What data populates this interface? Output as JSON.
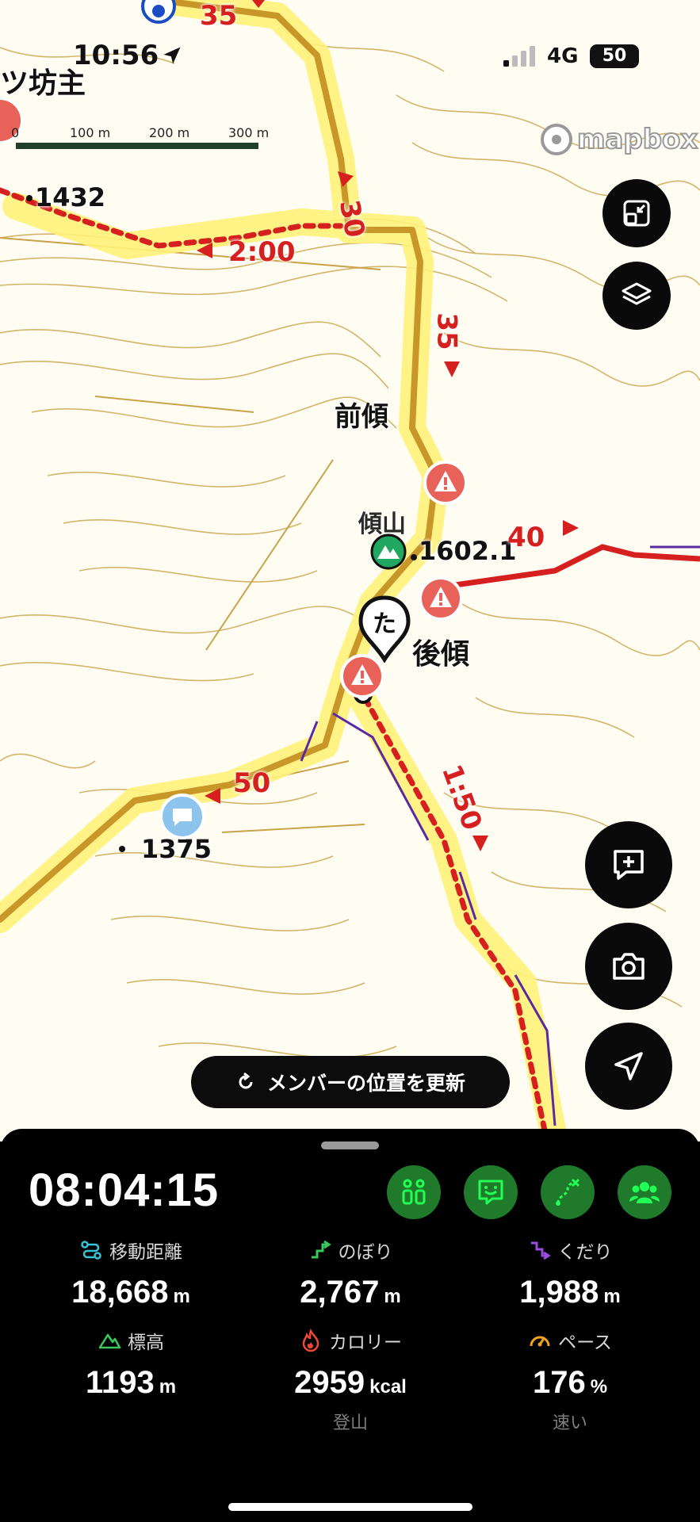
{
  "status_bar": {
    "time": "10:56",
    "network": "4G",
    "battery": "50"
  },
  "map": {
    "attribution": "mapbox",
    "scale_labels": [
      "0",
      "100 m",
      "200 m",
      "300 m"
    ],
    "place_labels": {
      "top_left": "ツ坊主",
      "mae_katamuki": "前傾",
      "katamuki_yama": "傾山",
      "ushiro_katamuki": "後傾"
    },
    "elevations": {
      "e1432": "1432",
      "e1602": "1602.1",
      "e1375": "1375"
    },
    "route_times": {
      "t35_top": "35",
      "t30": "30",
      "t200": "2:00",
      "t35": "35",
      "t40": "40",
      "t50": "50",
      "t150": "1:50"
    },
    "member_marker": "た"
  },
  "refresh_button": {
    "label": "メンバーの位置を更新"
  },
  "panel": {
    "elapsed": "08:04:15",
    "tools": [
      "route-icon",
      "chat-icon",
      "branch-route-icon",
      "group-icon"
    ],
    "stats": {
      "distance": {
        "label": "移動距離",
        "value": "18,668",
        "unit": "m"
      },
      "ascent": {
        "label": "のぼり",
        "value": "2,767",
        "unit": "m"
      },
      "descent": {
        "label": "くだり",
        "value": "1,988",
        "unit": "m"
      },
      "elevation": {
        "label": "標高",
        "value": "1193",
        "unit": "m"
      },
      "calories": {
        "label": "カロリー",
        "value": "2959",
        "unit": "kcal",
        "sub": "登山"
      },
      "pace": {
        "label": "ペース",
        "value": "176",
        "unit": "%",
        "sub": "速い"
      }
    }
  },
  "colors": {
    "route_red": "#d62020",
    "trail_gold": "#c9962a",
    "highlight_yellow": "#fff27a",
    "tool_green": "#1f7a2c"
  }
}
